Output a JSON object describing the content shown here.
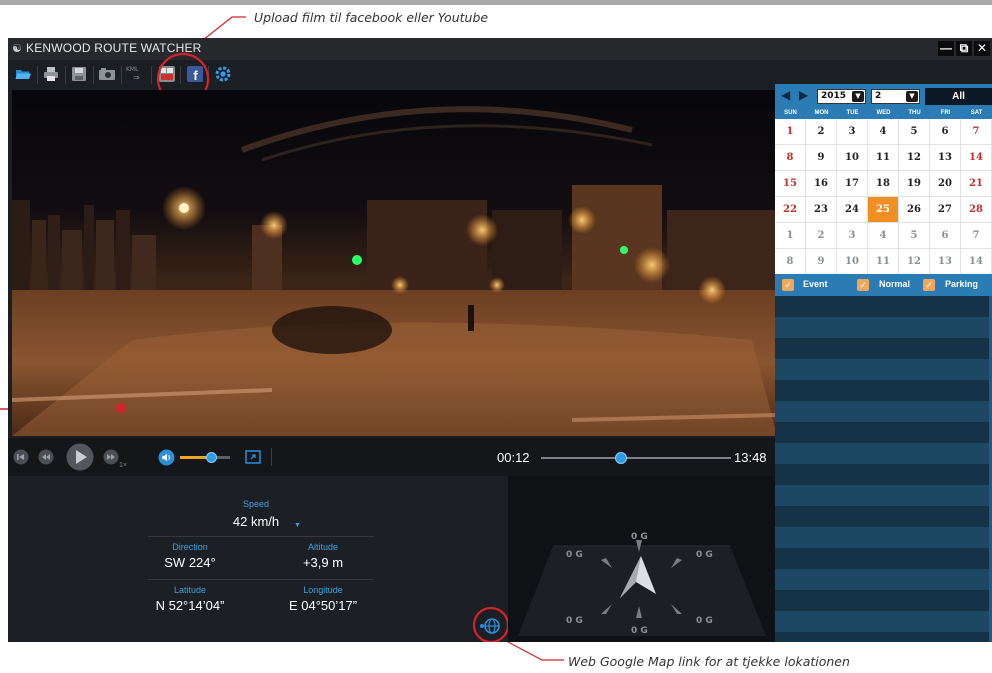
{
  "annotations": {
    "upload_note": "Upload film til facebook eller Youtube",
    "map_note": "Web Google Map link for at tjekke lokationen"
  },
  "window": {
    "title": "KENWOOD ROUTE WATCHER"
  },
  "toolbar": {
    "icons": [
      "folder-open-icon",
      "print-icon",
      "save-icon",
      "camera-icon",
      "kml-export-icon",
      "youtube-icon",
      "facebook-icon",
      "settings-icon"
    ],
    "kml_label": "KML"
  },
  "player": {
    "current_time": "00:12",
    "total_time": "13:48",
    "speed_multiplier": "1×",
    "progress": 0.42,
    "volume": 0.62
  },
  "info": {
    "speed_label": "Speed",
    "speed_value": "42 km/h",
    "direction_label": "Direction",
    "direction_value": "SW 224°",
    "altitude_label": "Altitude",
    "altitude_value": "+3,9 m",
    "latitude_label": "Latitude",
    "latitude_value": "N 52°14’04”",
    "longitude_label": "Longitude",
    "longitude_value": "E 04°50’17”"
  },
  "gsensor": {
    "top": "0 G",
    "top_left": "0 G",
    "top_right": "0 G",
    "bottom_left": "0 G",
    "bottom_right": "0 G",
    "bottom": "0 G"
  },
  "calendar": {
    "year": "2015",
    "month": "2",
    "view_button": "All",
    "weekdays": [
      "SUN",
      "MON",
      "TUE",
      "WED",
      "THU",
      "FRI",
      "SAT"
    ],
    "selected_day": "25",
    "weeks": [
      [
        "1",
        "2",
        "3",
        "4",
        "5",
        "6",
        "7"
      ],
      [
        "8",
        "9",
        "10",
        "11",
        "12",
        "13",
        "14"
      ],
      [
        "15",
        "16",
        "17",
        "18",
        "19",
        "20",
        "21"
      ],
      [
        "22",
        "23",
        "24",
        "25",
        "26",
        "27",
        "28"
      ],
      [
        "1",
        "2",
        "3",
        "4",
        "5",
        "6",
        "7"
      ],
      [
        "8",
        "9",
        "10",
        "11",
        "12",
        "13",
        "14"
      ]
    ]
  },
  "filters": {
    "event": "Event",
    "normal": "Normal",
    "parking": "Parking"
  },
  "colors": {
    "accent": "#2b7bb4",
    "highlight_day": "#f28f22",
    "weekend_red": "#c0302a",
    "annotation_red": "#d4232b"
  }
}
